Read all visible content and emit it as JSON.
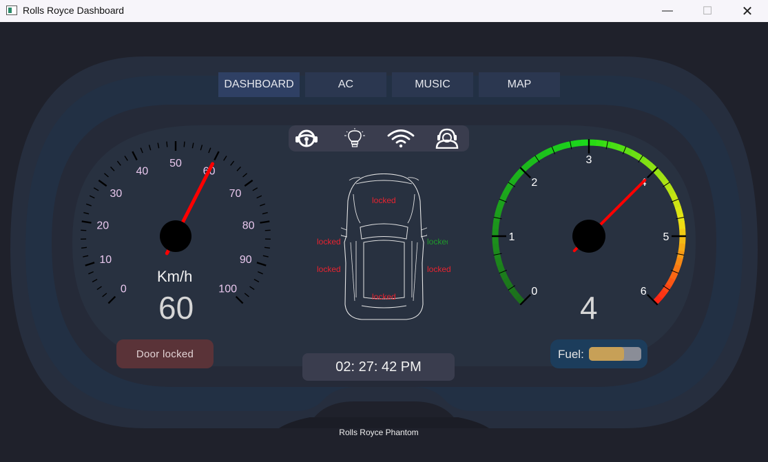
{
  "window": {
    "title": "Rolls Royce Dashboard",
    "min_glyph": "—",
    "max_glyph": "☐",
    "close_glyph": "✕"
  },
  "tabs": [
    {
      "label": "DASHBOARD",
      "active": true
    },
    {
      "label": "AC",
      "active": false
    },
    {
      "label": "MUSIC",
      "active": false
    },
    {
      "label": "MAP",
      "active": false
    }
  ],
  "status_icons": [
    "steering-wheel-icon",
    "light-bulb-icon",
    "wifi-icon",
    "driver-icon"
  ],
  "speedometer": {
    "ticks": [
      "0",
      "10",
      "20",
      "30",
      "40",
      "50",
      "60",
      "70",
      "80",
      "90",
      "100"
    ],
    "min": 0,
    "max": 100,
    "value": 60,
    "unit": "Km/h",
    "readout": "60"
  },
  "tachometer": {
    "ticks": [
      "0",
      "1",
      "2",
      "3",
      "4",
      "5",
      "6"
    ],
    "min": 0,
    "max": 6,
    "value": 4,
    "readout": "4"
  },
  "doors": {
    "front": "locked",
    "front_left": "locked",
    "front_right": "locked",
    "rear_left": "locked",
    "rear_right": "locked",
    "back": "locked"
  },
  "door_status": "Door locked",
  "clock": "02: 27: 42  PM",
  "fuel": {
    "label": "Fuel:",
    "level": 0.67
  },
  "model": "Rolls Royce Phantom",
  "colors": {
    "background": "#1f212b",
    "tab": "#2b3750",
    "needle": "#ff0000",
    "locked": "#e8232f",
    "unlocked": "#1f9a2a",
    "door_box": "#5a3338",
    "fuel_box": "#1c3d5c",
    "fuel_fill": "#c7a057"
  }
}
